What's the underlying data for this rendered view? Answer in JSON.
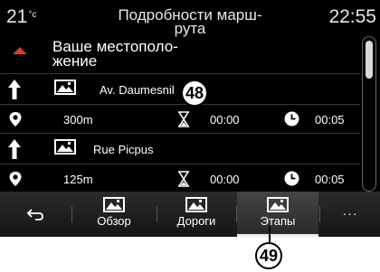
{
  "status": {
    "temperature": "21",
    "temperature_unit": "°c",
    "clock": "22:55"
  },
  "screen": {
    "title": "Подробности марш-\nрута"
  },
  "origin": {
    "label": "Ваше местополо-\nжение"
  },
  "steps": [
    {
      "street": "Av. Daumesnil",
      "distance": "300m",
      "time": "00:00",
      "arrival": "00:05"
    },
    {
      "street": "Rue Picpus",
      "distance": "125m",
      "time": "00:00",
      "arrival": "00:05"
    }
  ],
  "tabs": {
    "overview": "Обзор",
    "roads": "Дороги",
    "steps": "Этапы",
    "more": "···"
  },
  "callouts": {
    "a": "48",
    "b": "49"
  },
  "colors": {
    "accent": "#d63b2c",
    "background": "#000000"
  },
  "icons": [
    "back-arrow-icon",
    "straight-arrow-icon",
    "pin-icon",
    "hourglass-icon",
    "clock-icon",
    "image-icon",
    "chevron-up-icon"
  ]
}
